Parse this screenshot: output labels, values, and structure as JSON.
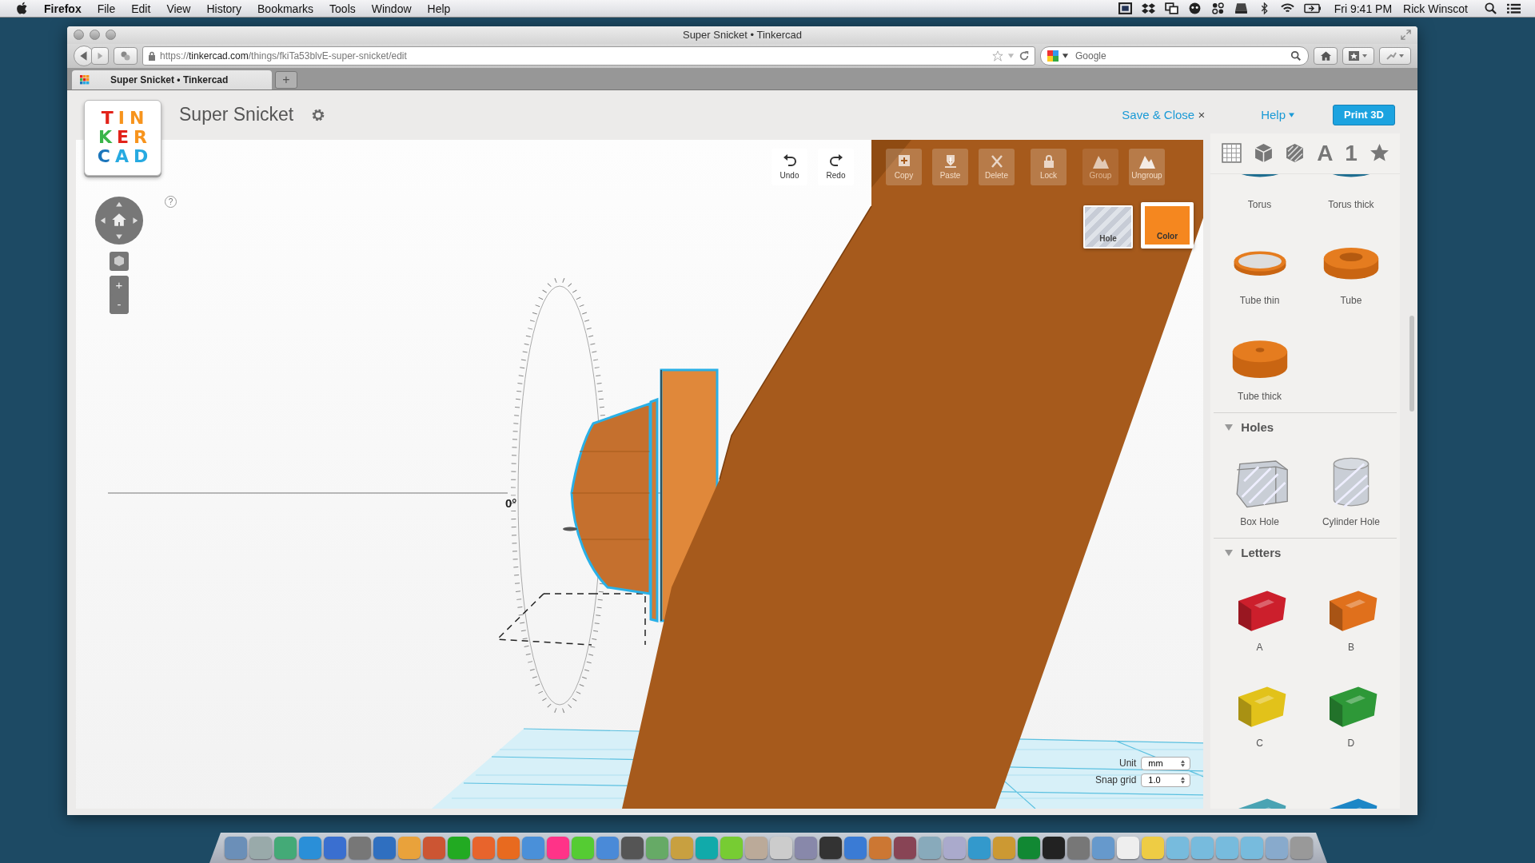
{
  "menubar": {
    "app": "Firefox",
    "menus": [
      "File",
      "Edit",
      "View",
      "History",
      "Bookmarks",
      "Tools",
      "Window",
      "Help"
    ],
    "clock": "Fri 9:41 PM",
    "user": "Rick Winscot"
  },
  "window": {
    "title": "Super Snicket • Tinkercad"
  },
  "navbar": {
    "url_scheme": "https://",
    "url_host": "tinkercad.com",
    "url_path": "/things/fkiTa53blvE-super-snicket/edit",
    "search_placeholder": "Google"
  },
  "tabs": [
    {
      "label": "Super Snicket • Tinkercad",
      "selected": true
    }
  ],
  "new_tab": "+",
  "header": {
    "logo_rows": [
      "TIN",
      "KER",
      "CAD"
    ],
    "design_title": "Super Snicket",
    "save_close": "Save & Close",
    "close_mark": "×",
    "help": "Help",
    "print": "Print 3D"
  },
  "toolbar": [
    {
      "kind": "plain",
      "buttons": [
        {
          "label": "Undo",
          "kind": "undo",
          "disabled": false
        },
        {
          "label": "Redo",
          "kind": "redo",
          "disabled": false
        }
      ]
    },
    {
      "kind": "overlay",
      "buttons": [
        {
          "label": "Copy",
          "kind": "copy",
          "disabled": false
        },
        {
          "label": "Paste",
          "kind": "paste",
          "disabled": false
        },
        {
          "label": "Delete",
          "kind": "delete",
          "disabled": false
        }
      ]
    },
    {
      "kind": "overlay",
      "buttons": [
        {
          "label": "Lock",
          "kind": "lock",
          "disabled": false
        }
      ]
    },
    {
      "kind": "overlay",
      "buttons": [
        {
          "label": "Group",
          "kind": "group",
          "disabled": true
        },
        {
          "label": "Ungroup",
          "kind": "ungroup",
          "disabled": false
        }
      ]
    }
  ],
  "swatches": [
    {
      "label": "Hole",
      "kind": "hole",
      "selected": false
    },
    {
      "label": "Color",
      "kind": "color",
      "selected": true
    }
  ],
  "viewport": {
    "angle_label": "0°",
    "help": "?",
    "zoom_in": "+",
    "zoom_out": "-"
  },
  "settings": [
    {
      "label": "Unit",
      "value": "mm"
    },
    {
      "label": "Snap grid",
      "value": "1.0"
    }
  ],
  "sidebar": {
    "tabs": [
      {
        "kind": "grid"
      },
      {
        "kind": "cube"
      },
      {
        "kind": "striped-cube"
      },
      {
        "kind": "text",
        "label": "A"
      },
      {
        "kind": "text",
        "label": "1"
      },
      {
        "kind": "star"
      }
    ],
    "sections": [
      {
        "items": [
          {
            "kind": "torus",
            "label": "Torus"
          },
          {
            "kind": "torus",
            "label": "Torus thick"
          },
          {
            "kind": "tube-thin",
            "label": "Tube thin"
          },
          {
            "kind": "tube",
            "label": "Tube"
          },
          {
            "kind": "tube-thick",
            "label": "Tube thick"
          }
        ]
      },
      {
        "title": "Holes",
        "expanded": true,
        "items": [
          {
            "kind": "box-hole",
            "label": "Box Hole"
          },
          {
            "kind": "cylinder-hole",
            "label": "Cylinder Hole"
          }
        ]
      },
      {
        "title": "Letters",
        "expanded": true,
        "items": [
          {
            "kind": "letter",
            "label": "A",
            "color": "#cc1f2c"
          },
          {
            "kind": "letter",
            "label": "B",
            "color": "#e0701c"
          },
          {
            "kind": "letter",
            "label": "C",
            "color": "#e2c21a"
          },
          {
            "kind": "letter",
            "label": "D",
            "color": "#2e9838"
          },
          {
            "kind": "letter",
            "color": "#4aa3b3"
          },
          {
            "kind": "letter",
            "color": "#1d86c6"
          }
        ]
      }
    ]
  }
}
